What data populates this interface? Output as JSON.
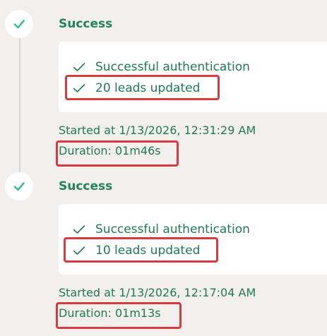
{
  "runs": [
    {
      "status": "Success",
      "steps": [
        {
          "icon": "check-icon",
          "label": "Successful authentication"
        },
        {
          "icon": "check-icon",
          "label": "20 leads updated"
        }
      ],
      "started_label": "Started at",
      "started_value": "1/13/2026, 12:31:29 AM",
      "duration_label": "Duration:",
      "duration_value": "01m46s"
    },
    {
      "status": "Success",
      "steps": [
        {
          "icon": "check-icon",
          "label": "Successful authentication"
        },
        {
          "icon": "check-icon",
          "label": "10 leads updated"
        }
      ],
      "started_label": "Started at",
      "started_value": "1/13/2026, 12:17:04 AM",
      "duration_label": "Duration:",
      "duration_value": "01m13s"
    }
  ],
  "colors": {
    "success_green": "#20835a",
    "highlight_red": "#d63b42",
    "background": "#f3efed"
  }
}
